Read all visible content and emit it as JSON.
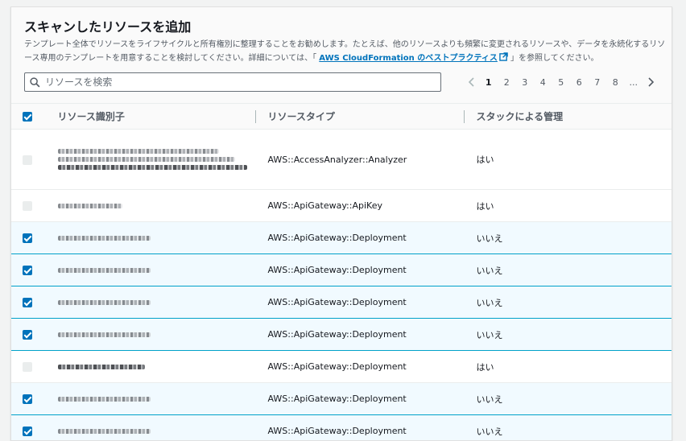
{
  "panel": {
    "title": "スキャンしたリソースを追加",
    "description_prefix": "テンプレート全体でリソースをライフサイクルと所有権別に整理することをお勧めします。たとえば、他のリソースよりも頻繁に変更されるリソースや、データを永続化するリソース専用のテンプレートを用意することを検討してください。詳細については、「 ",
    "description_link": "AWS CloudFormation のベストプラクティス",
    "description_suffix": " 」を参照してください。"
  },
  "search": {
    "placeholder": "リソースを検索",
    "value": ""
  },
  "pagination": {
    "pages": [
      "1",
      "2",
      "3",
      "4",
      "5",
      "6",
      "7",
      "8",
      "..."
    ],
    "current": "1"
  },
  "table": {
    "columns": [
      "リソース識別子",
      "リソースタイプ",
      "スタックによる管理"
    ],
    "header_checkbox": "checked",
    "rows": [
      {
        "selected": false,
        "type": "AWS::AccessAnalyzer::Analyzer",
        "managed": "はい"
      },
      {
        "selected": false,
        "type": "AWS::ApiGateway::ApiKey",
        "managed": "はい"
      },
      {
        "selected": true,
        "type": "AWS::ApiGateway::Deployment",
        "managed": "いいえ"
      },
      {
        "selected": true,
        "type": "AWS::ApiGateway::Deployment",
        "managed": "いいえ"
      },
      {
        "selected": true,
        "type": "AWS::ApiGateway::Deployment",
        "managed": "いいえ"
      },
      {
        "selected": true,
        "type": "AWS::ApiGateway::Deployment",
        "managed": "いいえ"
      },
      {
        "selected": false,
        "type": "AWS::ApiGateway::Deployment",
        "managed": "はい"
      },
      {
        "selected": true,
        "type": "AWS::ApiGateway::Deployment",
        "managed": "いいえ"
      },
      {
        "selected": true,
        "type": "AWS::ApiGateway::Deployment",
        "managed": "いいえ"
      }
    ]
  },
  "colors": {
    "accent": "#0073bb",
    "selected_border": "#00a1c9",
    "selected_bg": "#f1faff"
  },
  "icons": {
    "search": "search-icon",
    "external": "external-link-icon",
    "prev": "chevron-left-icon",
    "next": "chevron-right-icon"
  }
}
